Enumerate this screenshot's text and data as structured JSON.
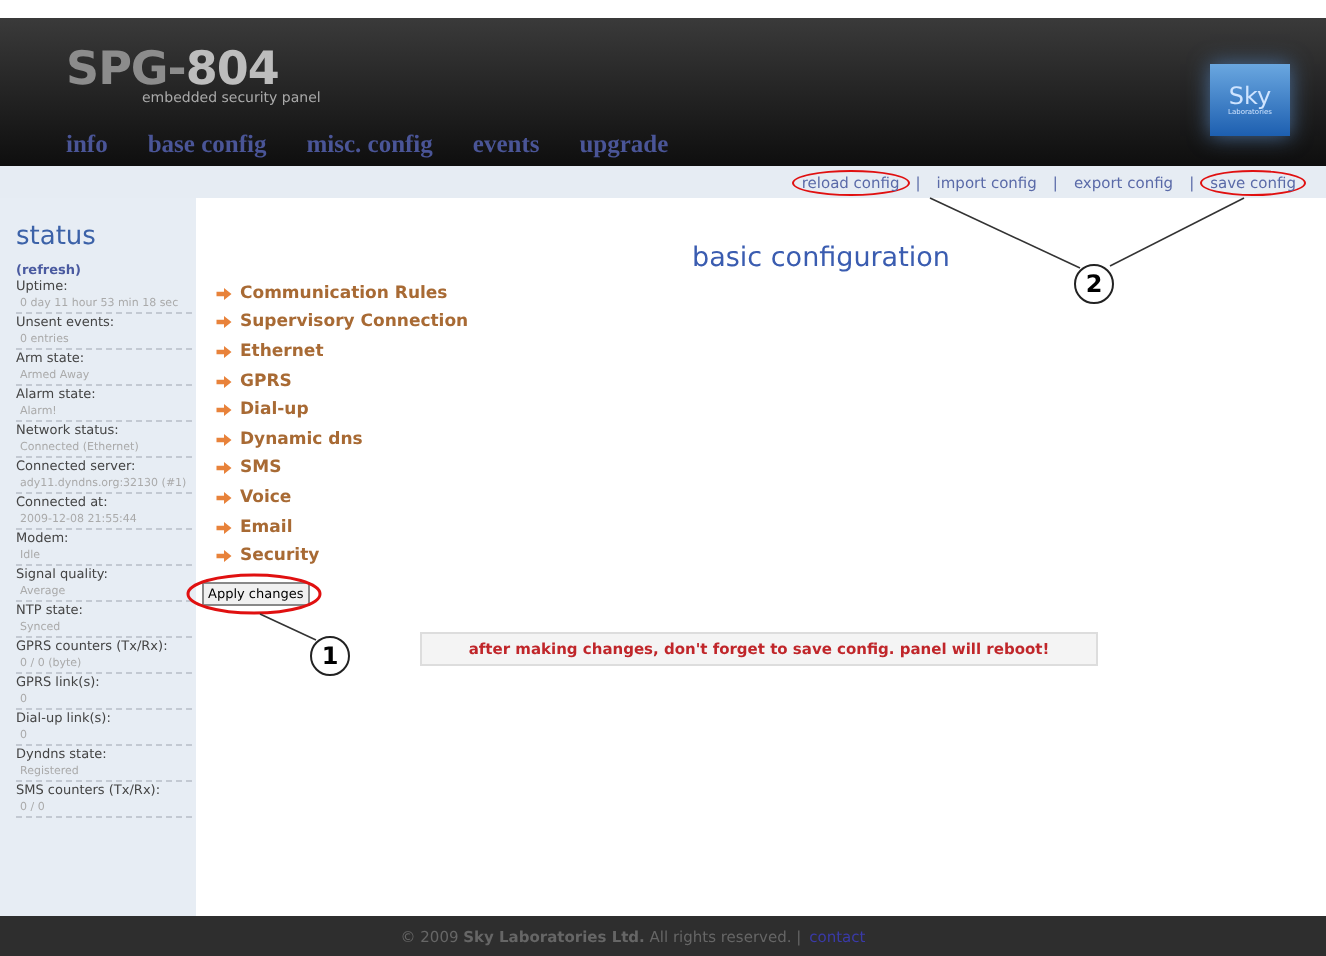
{
  "header": {
    "product": "SPG-",
    "model": "804",
    "subtitle": "embedded security panel",
    "logo": {
      "name": "Sky",
      "sub": "Laboratories"
    }
  },
  "nav": [
    {
      "label": "info"
    },
    {
      "label": "base config"
    },
    {
      "label": "misc. config"
    },
    {
      "label": "events"
    },
    {
      "label": "upgrade"
    }
  ],
  "toolbar_links": [
    {
      "label": "reload config",
      "circled": true
    },
    {
      "separator": "|",
      "label": "import config",
      "circled": false
    },
    {
      "separator": "|",
      "label": "export config",
      "circled": false
    },
    {
      "separator": "|",
      "label": "save config",
      "circled": true
    }
  ],
  "sidebar": {
    "title": "status",
    "refresh": "(refresh)",
    "items": [
      {
        "label": "Uptime:",
        "value": "0 day 11 hour 53 min 18 sec"
      },
      {
        "label": "Unsent events:",
        "value": "0 entries"
      },
      {
        "label": "Arm state:",
        "value": "Armed Away"
      },
      {
        "label": "Alarm state:",
        "value": "Alarm!"
      },
      {
        "label": "Network status:",
        "value": "Connected (Ethernet)"
      },
      {
        "label": "Connected server:",
        "value": "ady11.dyndns.org:32130 (#1)"
      },
      {
        "label": "Connected at:",
        "value": "2009-12-08 21:55:44"
      },
      {
        "label": "Modem:",
        "value": "Idle"
      },
      {
        "label": "Signal quality:",
        "value": "Average"
      },
      {
        "label": "NTP state:",
        "value": "Synced"
      },
      {
        "label": "GPRS counters (Tx/Rx):",
        "value": "0 / 0 (byte)"
      },
      {
        "label": "GPRS link(s):",
        "value": "0"
      },
      {
        "label": "Dial-up link(s):",
        "value": "0"
      },
      {
        "label": "Dyndns state:",
        "value": "Registered"
      },
      {
        "label": "SMS counters (Tx/Rx):",
        "value": "0 / 0"
      }
    ]
  },
  "main": {
    "title": "basic configuration",
    "sections": [
      "Communication Rules",
      "Supervisory Connection",
      "Ethernet",
      "GPRS",
      "Dial-up",
      "Dynamic dns",
      "SMS",
      "Voice",
      "Email",
      "Security"
    ],
    "apply_button": {
      "label": "Apply changes",
      "circled": true
    },
    "notice": "after making changes, don't forget to save config. panel will reboot!"
  },
  "callouts": [
    {
      "label": "1"
    },
    {
      "label": "2"
    }
  ],
  "footer": {
    "text": "© 2009 **Sky Laboratories Ltd.** All rights reserved. |",
    "link": "contact"
  }
}
